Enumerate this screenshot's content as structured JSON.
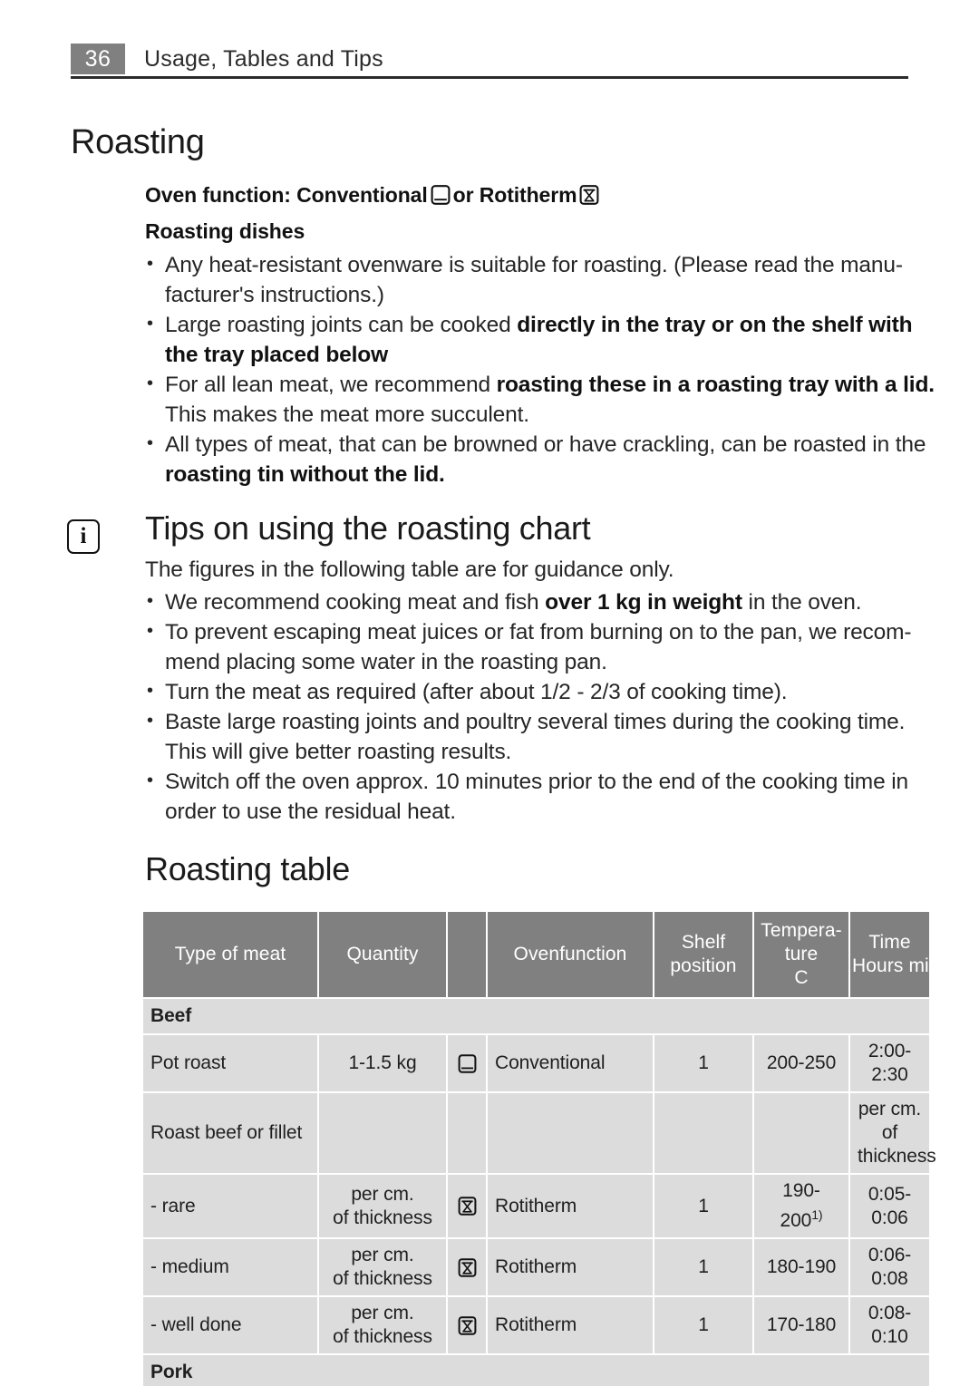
{
  "running_header": {
    "page_number": "36",
    "title": "Usage, Tables and Tips"
  },
  "sections": {
    "roasting_heading": "Roasting",
    "oven_function_label_before": "Oven function: Conventional",
    "oven_function_label_middle": "or Rotitherm",
    "roasting_dishes_heading": "Roasting dishes",
    "tips_heading": "Tips on using the roasting chart",
    "tips_lead": "The figures in the following table are for guidance only.",
    "roasting_table_heading": "Roasting table",
    "info_badge_glyph": "i"
  },
  "icons": {
    "conventional": "conventional-oven-icon",
    "rotitherm": "rotitherm-icon",
    "info": "info-icon"
  },
  "dishes_bullets": [
    {
      "parts": [
        {
          "text": "Any heat-resistant ovenware is suitable for roasting. (Please read the manu-facturer's instructions.)",
          "bold": false
        }
      ]
    },
    {
      "parts": [
        {
          "text": "Large roasting joints can be cooked ",
          "bold": false
        },
        {
          "text": "directly in the tray or on the shelf with the tray placed below",
          "bold": true
        }
      ]
    },
    {
      "parts": [
        {
          "text": "For all lean meat, we recommend ",
          "bold": false
        },
        {
          "text": "roasting these in a roasting tray with a lid.",
          "bold": true
        },
        {
          "text": " This makes the meat more succulent.",
          "bold": false
        }
      ]
    },
    {
      "parts": [
        {
          "text": "All types of meat, that can be browned or have crackling, can be roasted in the ",
          "bold": false
        },
        {
          "text": "roasting tin without the lid.",
          "bold": true
        }
      ]
    }
  ],
  "tips_bullets": [
    {
      "parts": [
        {
          "text": "We recommend cooking meat and fish ",
          "bold": false
        },
        {
          "text": "over 1 kg in weight",
          "bold": true
        },
        {
          "text": " in the oven.",
          "bold": false
        }
      ]
    },
    {
      "parts": [
        {
          "text": "To prevent escaping meat juices or fat from burning on to the pan, we recom-mend placing some water in the roasting pan.",
          "bold": false
        }
      ]
    },
    {
      "parts": [
        {
          "text": "Turn the meat as required (after about 1/2 - 2/3 of cooking time).",
          "bold": false
        }
      ]
    },
    {
      "parts": [
        {
          "text": "Baste large roasting joints and poultry several times during the cooking time. This will give better roasting results.",
          "bold": false
        }
      ]
    },
    {
      "parts": [
        {
          "text": "Switch off the oven approx. 10 minutes prior to the end of the cooking time in order to use the residual heat.",
          "bold": false
        }
      ]
    }
  ],
  "table": {
    "columns": [
      {
        "key": "type",
        "label": "Type of meat"
      },
      {
        "key": "quantity",
        "label": "Quantity"
      },
      {
        "key": "icon",
        "label": ""
      },
      {
        "key": "ovenfunction",
        "label": "Ovenfunction"
      },
      {
        "key": "shelf",
        "label_line1": "Shelf",
        "label_line2": "position"
      },
      {
        "key": "temperature",
        "label_line1": "Tempera-",
        "label_line2": "ture",
        "label_line3": "C"
      },
      {
        "key": "time",
        "label_line1": "Time",
        "label_line2": "Hours mins"
      }
    ],
    "groups": [
      {
        "name": "Beef",
        "rows": [
          {
            "type": "Pot roast",
            "quantity": "1-1.5 kg",
            "icon": "conventional-oven-icon",
            "ovenfunction": "Conventional",
            "shelf": "1",
            "temperature": "200-250",
            "temperature_footnote": "",
            "time": "2:00-2:30"
          },
          {
            "type": "Roast beef or fillet",
            "quantity": "",
            "icon": "",
            "ovenfunction": "",
            "shelf": "",
            "temperature": "",
            "temperature_footnote": "",
            "time": "per cm. of thickness"
          },
          {
            "type": "- rare",
            "quantity": "per cm. of thickness",
            "icon": "rotitherm-icon",
            "ovenfunction": "Rotitherm",
            "shelf": "1",
            "temperature": "190-200",
            "temperature_footnote": "1)",
            "time": "0:05-0:06"
          },
          {
            "type": "- medium",
            "quantity": "per cm. of thickness",
            "icon": "rotitherm-icon",
            "ovenfunction": "Rotitherm",
            "shelf": "1",
            "temperature": "180-190",
            "temperature_footnote": "",
            "time": "0:06-0:08"
          },
          {
            "type": "- well done",
            "quantity": "per cm. of thickness",
            "icon": "rotitherm-icon",
            "ovenfunction": "Rotitherm",
            "shelf": "1",
            "temperature": "170-180",
            "temperature_footnote": "",
            "time": "0:08-0:10"
          }
        ]
      },
      {
        "name": "Pork",
        "rows": []
      }
    ]
  },
  "colors": {
    "header_gray": "#808080",
    "cell_gray": "#dcdcdc",
    "rule_dark": "#2b2b2b",
    "text": "#262626"
  }
}
